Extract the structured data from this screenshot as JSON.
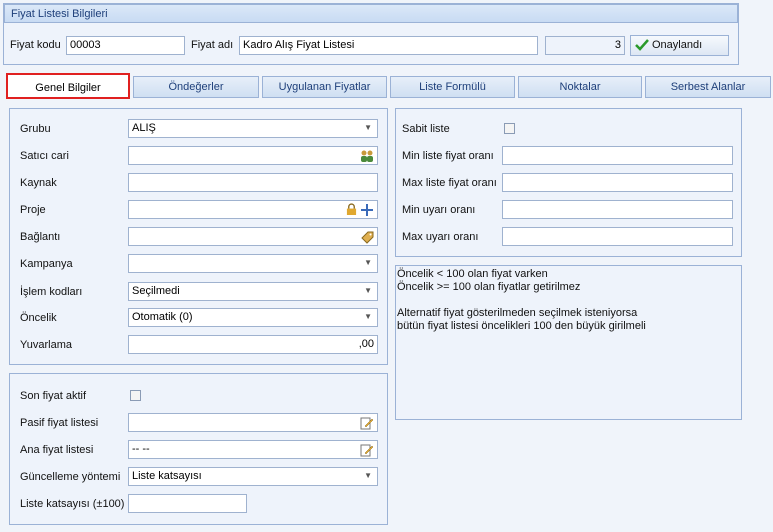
{
  "header": {
    "title": "Fiyat Listesi Bilgileri",
    "code_label": "Fiyat kodu",
    "code_value": "00003",
    "name_label": "Fiyat adı",
    "name_value": "Kadro Alış Fiyat Listesi",
    "count_value": "3",
    "approved_label": "Onaylandı"
  },
  "tabs": [
    "Genel Bilgiler",
    "Öndeğerler",
    "Uygulanan Fiyatlar",
    "Liste Formülü",
    "Noktalar",
    "Serbest Alanlar"
  ],
  "general": {
    "grubu_label": "Grubu",
    "grubu_value": "ALIŞ",
    "satici_label": "Satıcı cari",
    "satici_value": "",
    "kaynak_label": "Kaynak",
    "kaynak_value": "",
    "proje_label": "Proje",
    "proje_value": "",
    "baglanti_label": "Bağlantı",
    "baglanti_value": "",
    "kampanya_label": "Kampanya",
    "kampanya_value": "",
    "islem_label": "İşlem kodları",
    "islem_value": "Seçilmedi",
    "oncelik_label": "Öncelik",
    "oncelik_value": "Otomatik (0)",
    "yuvarlama_label": "Yuvarlama",
    "yuvarlama_value": ",00"
  },
  "last": {
    "son_label": "Son fiyat aktif",
    "pasif_label": "Pasif fiyat listesi",
    "pasif_value": "",
    "ana_label": "Ana fiyat listesi",
    "ana_value": "-- --",
    "guncelleme_label": "Güncelleme yöntemi",
    "guncelleme_value": "Liste katsayısı",
    "katsayi_label": "Liste katsayısı (±100)",
    "katsayi_value": ""
  },
  "right": {
    "sabit_label": "Sabit liste",
    "min_fiyat_label": "Min liste fiyat oranı",
    "max_fiyat_label": "Max liste fiyat oranı",
    "min_uyari_label": "Min uyarı oranı",
    "max_uyari_label": "Max uyarı oranı"
  },
  "info": {
    "line1": "Öncelik < 100 olan fiyat varken",
    "line2": "Öncelik >= 100 olan fiyatlar getirilmez",
    "line3": "Alternatif fiyat gösterilmeden seçilmek isteniyorsa",
    "line4": "bütün fiyat listesi öncelikleri 100 den büyük girilmeli"
  },
  "icons": {
    "satici": "people-icon",
    "proje_lock": "lock-icon",
    "proje_add": "plus-icon",
    "baglanti": "tag-icon",
    "pasif": "edit-icon",
    "ana": "edit-icon",
    "approved": "checkmark-icon"
  }
}
